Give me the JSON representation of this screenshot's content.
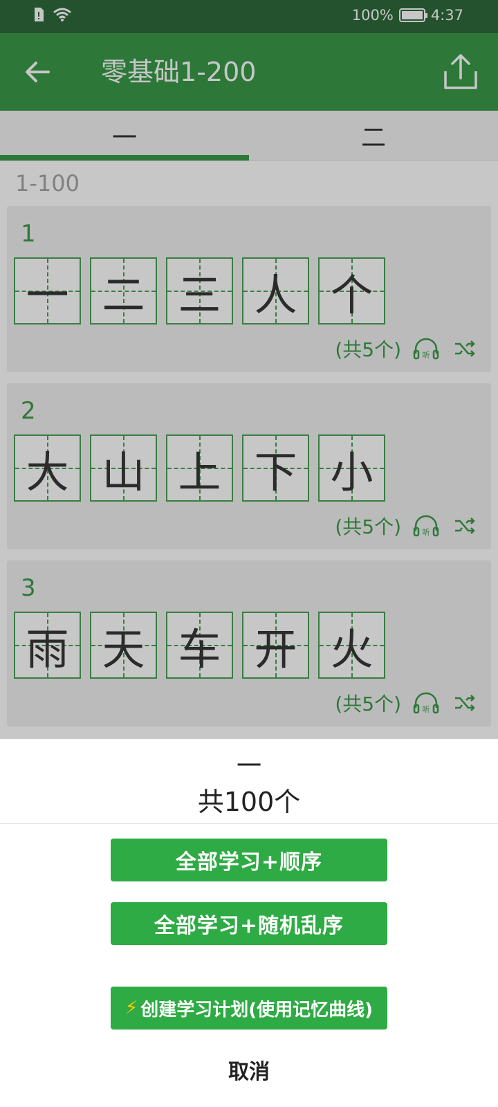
{
  "status_bar": {
    "battery": "100%",
    "time": "4:37"
  },
  "header": {
    "title": "零基础1-200"
  },
  "tabs": [
    {
      "label": "一"
    },
    {
      "label": "二"
    }
  ],
  "section": {
    "label": "1-100"
  },
  "groups": [
    {
      "number": "1",
      "chars": [
        "一",
        "二",
        "三",
        "人",
        "个"
      ],
      "count": "(共5个)"
    },
    {
      "number": "2",
      "chars": [
        "大",
        "山",
        "上",
        "下",
        "小"
      ],
      "count": "(共5个)"
    },
    {
      "number": "3",
      "chars": [
        "雨",
        "天",
        "车",
        "开",
        "火"
      ],
      "count": "(共5个)"
    }
  ],
  "sheet": {
    "title": "一",
    "subtitle": "共100个",
    "btn_sequential": "全部学习+顺序",
    "btn_random": "全部学习+随机乱序",
    "btn_plan": "创建学习计划(使用记忆曲线)",
    "cancel": "取消"
  },
  "colors": {
    "primary": "#3a9a4a",
    "button": "#2eab44",
    "status_bar": "#2f6a3c"
  },
  "icons": [
    "back-arrow-icon",
    "share-icon",
    "listen-icon",
    "shuffle-icon",
    "lightning-icon"
  ]
}
